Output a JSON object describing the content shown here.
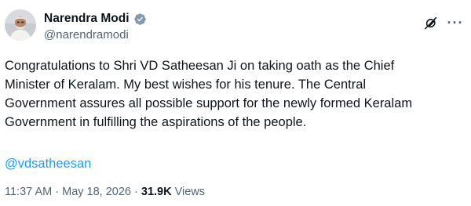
{
  "author": {
    "display_name": "Narendra Modi",
    "handle": "@narendramodi",
    "verified_badge_color": "#829aab"
  },
  "icons": {
    "verified": "verified-badge-icon",
    "grok": "grok-icon",
    "more": "more-icon"
  },
  "tweet": {
    "text_lines": [
      "Congratulations to Shri VD Satheesan Ji on taking oath as the Chief",
      "Minister of Keralam. My best wishes for his tenure. The Central",
      "Government assures all possible support for the newly formed Keralam",
      "Government in fulfilling the aspirations of the people."
    ],
    "mention": "@vdsatheesan"
  },
  "meta": {
    "time": "11:37 AM",
    "separator": "·",
    "date": "May 18, 2026",
    "views_count": "31.9K",
    "views_label": "Views"
  },
  "colors": {
    "text_primary": "#0f1419",
    "text_secondary": "#536471",
    "link": "#1d9bf0"
  }
}
